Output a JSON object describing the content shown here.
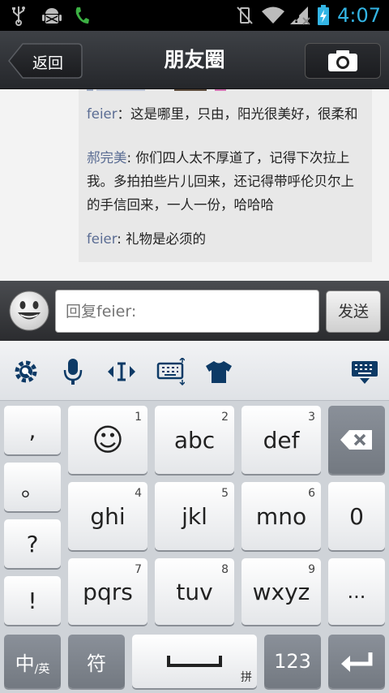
{
  "status_bar": {
    "time": "4:07"
  },
  "header": {
    "back_label": "返回",
    "title": "朋友圈"
  },
  "comments": [
    {
      "name": "feier",
      "sep": "：",
      "text": "这是哪里，只由，阳光很美好，很柔和"
    },
    {
      "name": "郝完美",
      "sep": ":",
      "text": "你们四人太不厚道了，记得下次拉上我。多拍拍些片儿回来，还记得带呼伦贝尔上的手信回来，一人一份，哈哈哈"
    },
    {
      "name": "feier",
      "sep": ":",
      "text": "礼物是必须的"
    }
  ],
  "reply": {
    "placeholder": "回复feier:",
    "send_label": "发送"
  },
  "keyboard": {
    "left_column": [
      ",",
      "。",
      "?",
      "!"
    ],
    "keys": [
      {
        "label": "☺",
        "num": "1"
      },
      {
        "label": "abc",
        "num": "2"
      },
      {
        "label": "def",
        "num": "3"
      },
      {
        "label": "ghi",
        "num": "4"
      },
      {
        "label": "jkl",
        "num": "5"
      },
      {
        "label": "mno",
        "num": "6"
      },
      {
        "label": "0",
        "num": ""
      },
      {
        "label": "pqrs",
        "num": "7"
      },
      {
        "label": "tuv",
        "num": "8"
      },
      {
        "label": "wxyz",
        "num": "9"
      },
      {
        "label": "...",
        "num": ""
      }
    ],
    "lang_main": "中",
    "lang_sub": "/英",
    "symbol_label": "符",
    "space_corner": "拼",
    "num_label": "123"
  },
  "colors": {
    "clock": "#33b5e5",
    "name": "#5a6c93"
  }
}
